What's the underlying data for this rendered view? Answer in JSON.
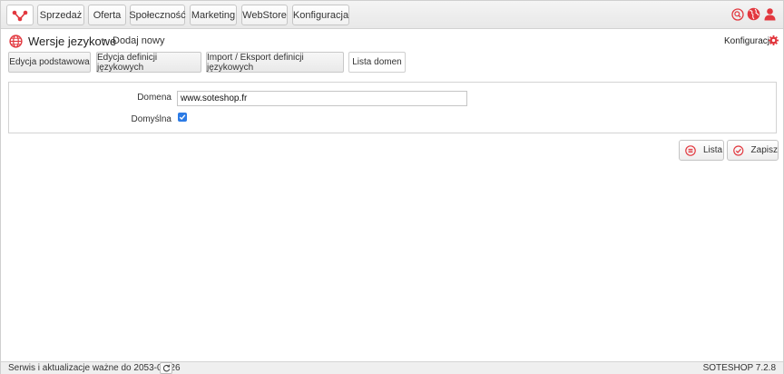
{
  "brand": {
    "accent": "#e2383f"
  },
  "nav": {
    "items": [
      {
        "label": "Sprzedaż"
      },
      {
        "label": "Oferta"
      },
      {
        "label": "Społeczność"
      },
      {
        "label": "Marketing"
      },
      {
        "label": "WebStore"
      },
      {
        "label": "Konfiguracja"
      }
    ],
    "right_icons": [
      "search-icon",
      "globe-icon",
      "user-icon"
    ]
  },
  "breadcrumb": {
    "title": "Wersje jezykowe",
    "separator": "►",
    "current": "Dodaj nowy",
    "config_link": "Konfiguracja"
  },
  "tabs": [
    {
      "label": "Edycja podstawowa",
      "active": false
    },
    {
      "label": "Edycja definicji językowych",
      "active": false
    },
    {
      "label": "Import / Eksport definicji językowych",
      "active": false
    },
    {
      "label": "Lista domen",
      "active": true
    }
  ],
  "form": {
    "domain_label": "Domena",
    "domain_value": "www.soteshop.fr",
    "default_label": "Domyślna",
    "default_checked": true
  },
  "actions": {
    "list_label": "Lista",
    "save_label": "Zapisz"
  },
  "footer": {
    "service_text": "Serwis i aktualizacje ważne do 2053-08-26",
    "version": "SOTESHOP 7.2.8"
  }
}
